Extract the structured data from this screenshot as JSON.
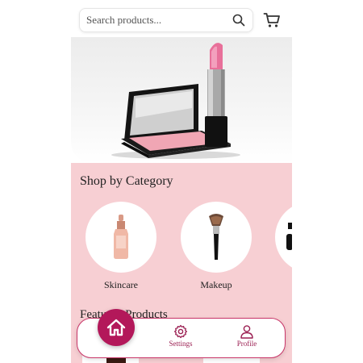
{
  "header": {
    "search_placeholder": "Search products...",
    "search_icon": "search-icon",
    "cart_icon": "cart-icon"
  },
  "hero": {
    "image": "makeup-compact-and-pink-lipstick"
  },
  "categories": {
    "title": "Shop by Category",
    "items": [
      {
        "label": "Skincare",
        "icon": "serum-bottle"
      },
      {
        "label": "Makeup",
        "icon": "makeup-brush"
      },
      {
        "label": "",
        "icon": "partially-visible-category"
      }
    ]
  },
  "featured": {
    "title": "Featured Products"
  },
  "bottom_nav": {
    "home_icon": "home-icon",
    "settings_label": "Settings",
    "profile_label": "Profile"
  },
  "colors": {
    "accent": "#b3185a",
    "content_bg": "#f7cfd3",
    "nav_text": "#9b1f52"
  }
}
